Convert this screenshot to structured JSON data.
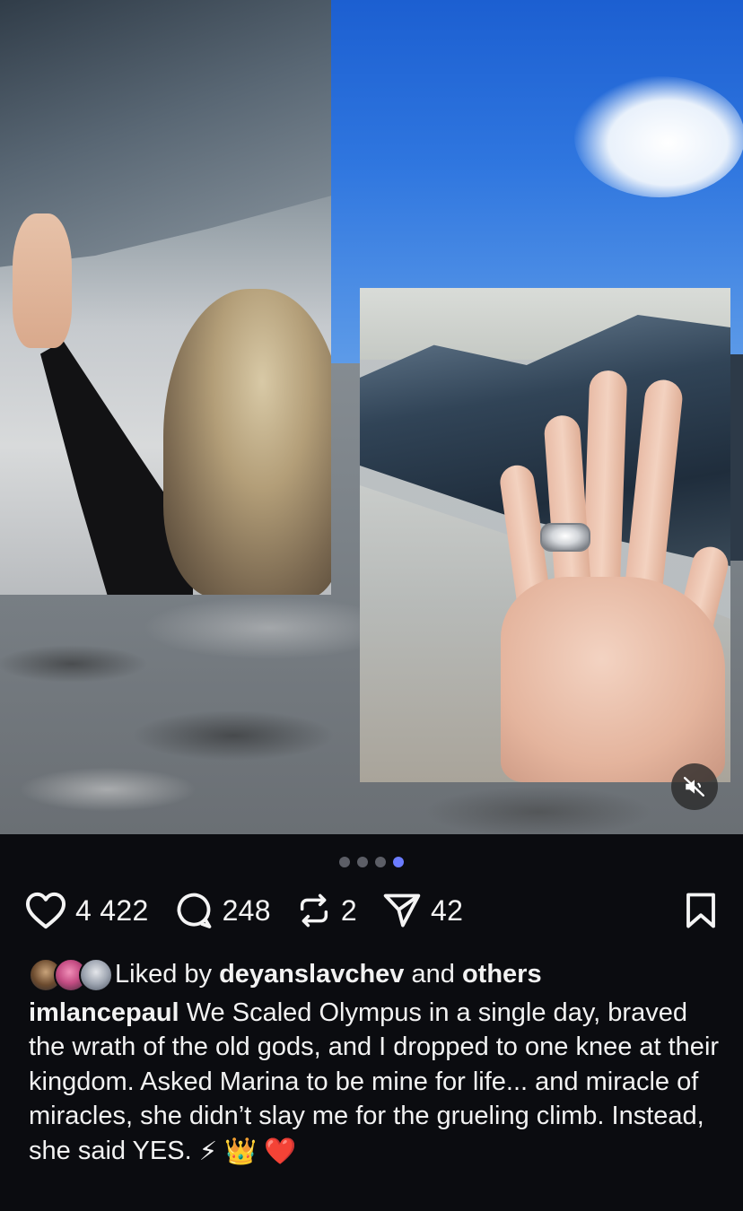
{
  "media": {
    "carousel_index": 4,
    "carousel_count": 4,
    "mute_icon": "speaker-muted-icon"
  },
  "actions": {
    "like_count": "4 422",
    "comment_count": "248",
    "repost_count": "2",
    "share_count": "42"
  },
  "liked_by": {
    "prefix": "Liked by",
    "user": "deyanslavchev",
    "and": "and",
    "others": "others"
  },
  "caption": {
    "username": "imlancepaul",
    "text": "We Scaled Olympus in a single day, braved the wrath of the old gods, and I dropped to one knee at their kingdom. Asked Marina to be mine for life... and miracle of miracles, she didn’t slay me for the grueling climb. Instead, she said YES.",
    "emoji": "⚡ 👑 ❤️"
  },
  "colors": {
    "background": "#0b0c10",
    "active_dot": "#6b7cff",
    "inactive_dot": "#5c5e66",
    "text": "#f2f2f2"
  }
}
